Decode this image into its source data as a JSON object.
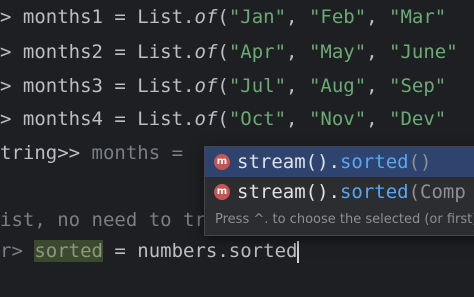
{
  "editor": {
    "lines": [
      {
        "prefix": "> ",
        "var": "months1",
        "eq": " = ",
        "cls": "List.",
        "method": "of",
        "open": "(",
        "s1": "\"Jan\"",
        "c1": ", ",
        "s2": "\"Feb\"",
        "c2": ", ",
        "s3": "\"Mar\""
      },
      {
        "prefix": "> ",
        "var": "months2",
        "eq": " = ",
        "cls": "List.",
        "method": "of",
        "open": "(",
        "s1": "\"Apr\"",
        "c1": ", ",
        "s2": "\"May\"",
        "c2": ", ",
        "s3": "\"June\""
      },
      {
        "prefix": "> ",
        "var": "months3",
        "eq": " = ",
        "cls": "List.",
        "method": "of",
        "open": "(",
        "s1": "\"Jul\"",
        "c1": ", ",
        "s2": "\"Aug\"",
        "c2": ", ",
        "s3": "\"Sep\""
      },
      {
        "prefix": "> ",
        "var": "months4",
        "eq": " = ",
        "cls": "List.",
        "method": "of",
        "open": "(",
        "s1": "\"Oct\"",
        "c1": ", ",
        "s2": "\"Nov\"",
        "c2": ", ",
        "s3": "\"Dev\""
      }
    ],
    "line5": {
      "type": "tring>> ",
      "var": "months",
      "rest": " = "
    },
    "line6": {
      "text": "ist, no need to tr"
    },
    "line7": {
      "prefix": "r> ",
      "var": "sorted",
      "eq": " = ",
      "expr": "numbers.sorted"
    }
  },
  "completion": {
    "items": [
      {
        "badge": "m",
        "name": "stream()",
        "dot": ".",
        "method": "sorted",
        "args": "()"
      },
      {
        "badge": "m",
        "name": "stream()",
        "dot": ".",
        "method": "sorted",
        "args": "(Comp"
      }
    ],
    "hint": "Press ^. to choose the selected (or first)"
  },
  "colors": {
    "background": "#1e1f22",
    "keyword": "#cf8e6d",
    "string": "#6aab73",
    "method": "#56a8f5",
    "selection": "#2e436e",
    "badge": "#c75450"
  }
}
